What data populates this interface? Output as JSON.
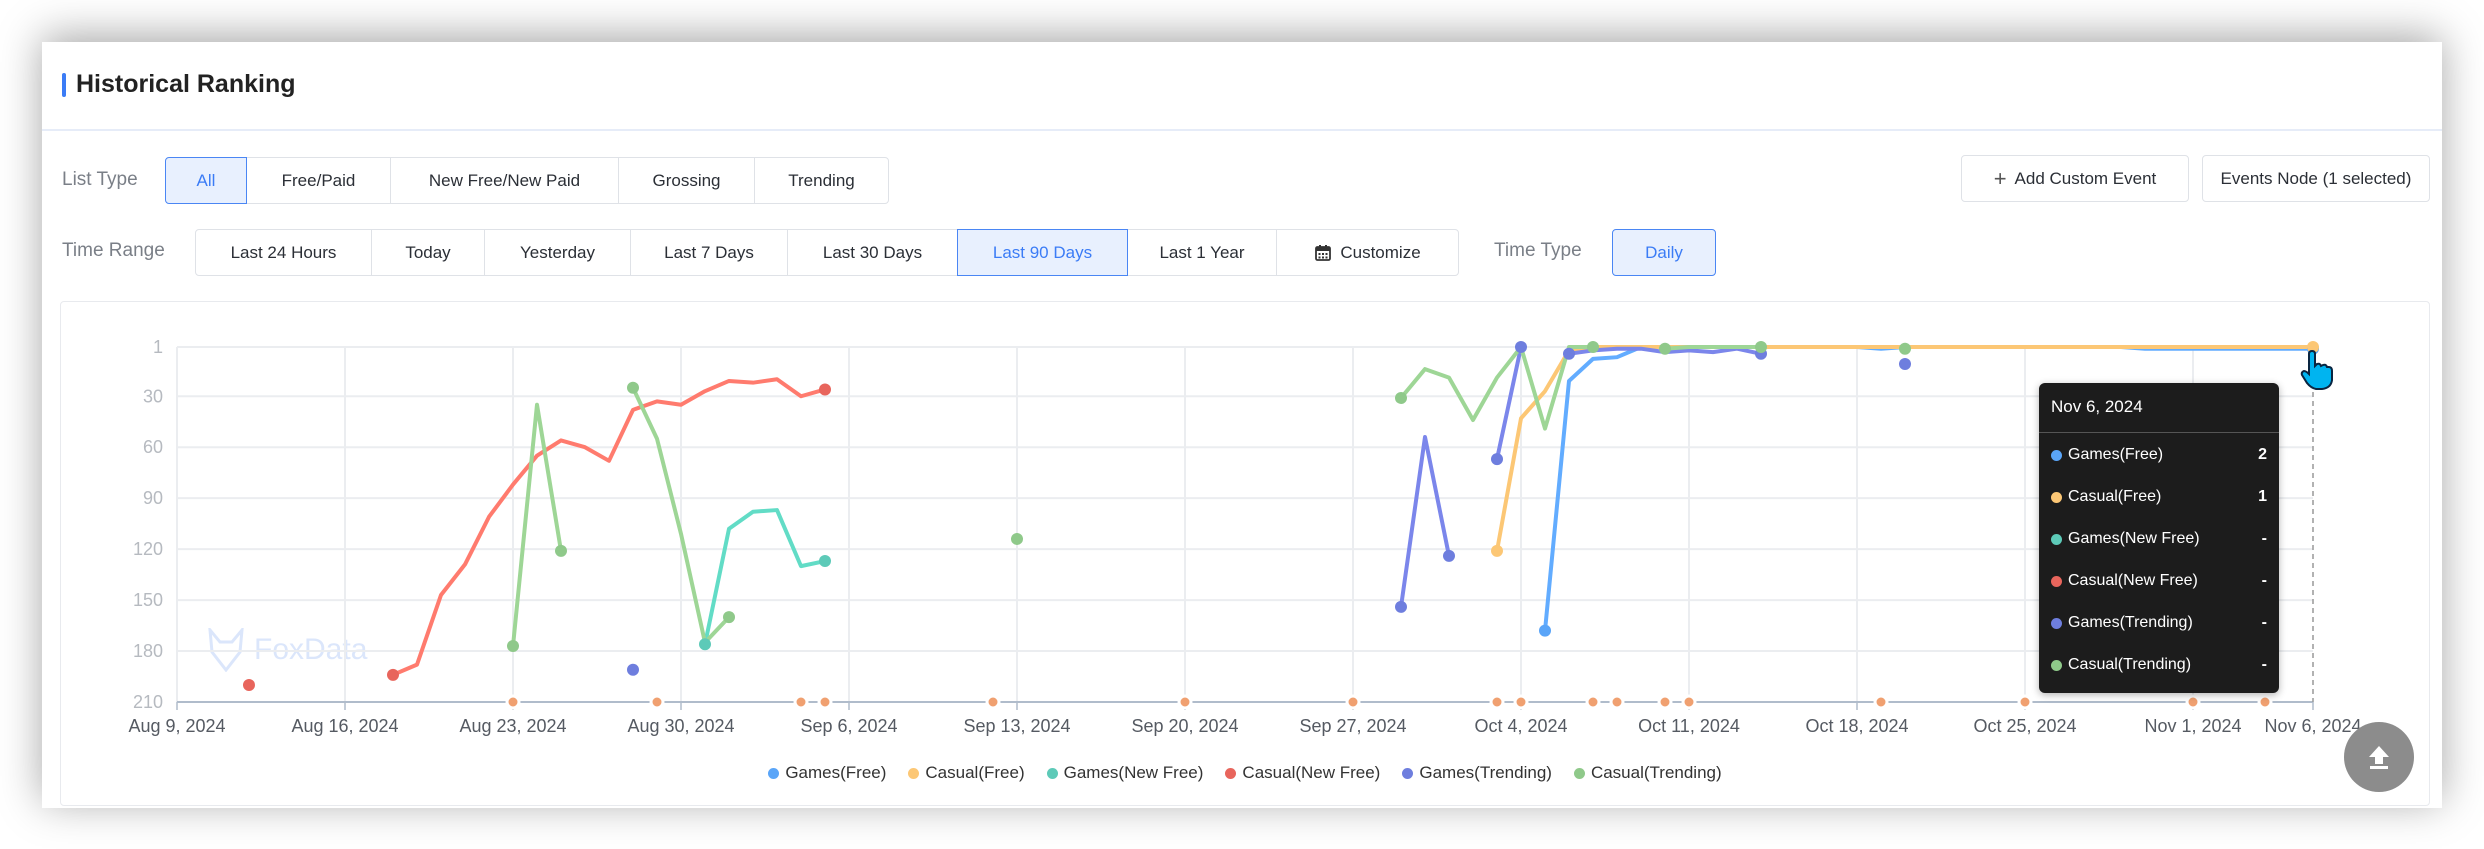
{
  "header": {
    "title": "Historical Ranking"
  },
  "filters": {
    "list_type_label": "List Type",
    "list_types": [
      "All",
      "Free/Paid",
      "New Free/New Paid",
      "Grossing",
      "Trending"
    ],
    "list_type_selected": "All",
    "time_range_label": "Time Range",
    "time_ranges": [
      "Last 24 Hours",
      "Today",
      "Yesterday",
      "Last 7 Days",
      "Last 30 Days",
      "Last 90 Days",
      "Last 1 Year",
      "Customize"
    ],
    "time_range_selected": "Last 90 Days",
    "time_type_label": "Time Type",
    "time_type": "Daily",
    "add_custom_event": "Add Custom Event",
    "events_node": "Events Node (1 selected)"
  },
  "watermark": "FoxData",
  "tooltip": {
    "date": "Nov 6, 2024",
    "rows": [
      {
        "name": "Games(Free)",
        "value": "2",
        "color": "#5aa5f8"
      },
      {
        "name": "Casual(Free)",
        "value": "1",
        "color": "#fcc775"
      },
      {
        "name": "Games(New Free)",
        "value": "-",
        "color": "#5dcab8"
      },
      {
        "name": "Casual(New Free)",
        "value": "-",
        "color": "#e8655c"
      },
      {
        "name": "Games(Trending)",
        "value": "-",
        "color": "#6e7ede"
      },
      {
        "name": "Casual(Trending)",
        "value": "-",
        "color": "#8fc98a"
      }
    ]
  },
  "chart_data": {
    "type": "line",
    "title": "",
    "xlabel": "",
    "ylabel": "",
    "y_inverted": true,
    "ylim": [
      1,
      210
    ],
    "y_ticks": [
      "1",
      "30",
      "60",
      "90",
      "120",
      "150",
      "180",
      "210"
    ],
    "xlim": [
      "2024-08-09",
      "2024-11-06"
    ],
    "x_ticks": [
      {
        "date": "2024-08-09",
        "label": "Aug 9, 2024"
      },
      {
        "date": "2024-08-16",
        "label": "Aug 16, 2024"
      },
      {
        "date": "2024-08-23",
        "label": "Aug 23, 2024"
      },
      {
        "date": "2024-08-30",
        "label": "Aug 30, 2024"
      },
      {
        "date": "2024-09-06",
        "label": "Sep 6, 2024"
      },
      {
        "date": "2024-09-13",
        "label": "Sep 13, 2024"
      },
      {
        "date": "2024-09-20",
        "label": "Sep 20, 2024"
      },
      {
        "date": "2024-09-27",
        "label": "Sep 27, 2024"
      },
      {
        "date": "2024-10-04",
        "label": "Oct 4, 2024"
      },
      {
        "date": "2024-10-11",
        "label": "Oct 11, 2024"
      },
      {
        "date": "2024-10-18",
        "label": "Oct 18, 2024"
      },
      {
        "date": "2024-10-25",
        "label": "Oct 25, 2024"
      },
      {
        "date": "2024-11-01",
        "label": "Nov 1, 2024"
      },
      {
        "date": "2024-11-06",
        "label": "Nov 6, 2024"
      }
    ],
    "grid": true,
    "legend_position": "bottom",
    "event_color": "#f0a070",
    "events": [
      "2024-08-23",
      "2024-08-29",
      "2024-09-04",
      "2024-09-05",
      "2024-09-12",
      "2024-09-20",
      "2024-09-27",
      "2024-10-03",
      "2024-10-04",
      "2024-10-07",
      "2024-10-08",
      "2024-10-10",
      "2024-10-11",
      "2024-10-19",
      "2024-10-25",
      "2024-11-01",
      "2024-11-04"
    ],
    "series": [
      {
        "name": "Games(Free)",
        "color": "#62acff",
        "dot_color": "#5aa5f8",
        "segments": [
          [
            [
              "2024-10-05",
              168
            ],
            [
              "2024-10-06",
              21
            ],
            [
              "2024-10-07",
              8
            ],
            [
              "2024-10-08",
              7
            ],
            [
              "2024-10-09",
              1
            ],
            [
              "2024-10-18",
              1
            ],
            [
              "2024-10-19",
              2
            ],
            [
              "2024-10-20",
              1
            ],
            [
              "2024-10-29",
              1
            ],
            [
              "2024-10-30",
              2
            ],
            [
              "2024-11-06",
              2
            ]
          ]
        ]
      },
      {
        "name": "Casual(Free)",
        "color": "#fcc775",
        "dot_color": "#fcc775",
        "segments": [
          [
            [
              "2024-10-03",
              121
            ],
            [
              "2024-10-04",
              43
            ],
            [
              "2024-10-05",
              27
            ],
            [
              "2024-10-06",
              3
            ],
            [
              "2024-10-07",
              1
            ],
            [
              "2024-11-06",
              1
            ]
          ]
        ]
      },
      {
        "name": "Games(New Free)",
        "color": "#62dcc6",
        "dot_color": "#5dcab8",
        "segments": [
          [
            [
              "2024-08-31",
              176
            ],
            [
              "2024-09-01",
              108
            ],
            [
              "2024-09-02",
              98
            ],
            [
              "2024-09-03",
              97
            ],
            [
              "2024-09-04",
              130
            ],
            [
              "2024-09-05",
              127
            ]
          ]
        ]
      },
      {
        "name": "Casual(New Free)",
        "color": "#ff7b6e",
        "dot_color": "#e8655c",
        "segments": [
          [
            [
              "2024-08-12",
              200
            ]
          ],
          [
            [
              "2024-08-18",
              194
            ],
            [
              "2024-08-19",
              188
            ],
            [
              "2024-08-20",
              147
            ],
            [
              "2024-08-21",
              129
            ],
            [
              "2024-08-22",
              101
            ],
            [
              "2024-08-23",
              82
            ],
            [
              "2024-08-24",
              65
            ],
            [
              "2024-08-25",
              56
            ],
            [
              "2024-08-26",
              60
            ],
            [
              "2024-08-27",
              68
            ],
            [
              "2024-08-28",
              38
            ],
            [
              "2024-08-29",
              33
            ],
            [
              "2024-08-30",
              35
            ],
            [
              "2024-08-31",
              27
            ],
            [
              "2024-09-01",
              21
            ],
            [
              "2024-09-02",
              22
            ],
            [
              "2024-09-03",
              20
            ],
            [
              "2024-09-04",
              30
            ],
            [
              "2024-09-05",
              26
            ]
          ]
        ]
      },
      {
        "name": "Games(Trending)",
        "color": "#7b86eb",
        "dot_color": "#6e7ede",
        "segments": [
          [
            [
              "2024-08-28",
              191
            ]
          ],
          [
            [
              "2024-09-29",
              154
            ],
            [
              "2024-09-30",
              54
            ],
            [
              "2024-10-01",
              124
            ]
          ],
          [
            [
              "2024-10-03",
              67
            ],
            [
              "2024-10-04",
              1
            ]
          ],
          [
            [
              "2024-10-06",
              5
            ],
            [
              "2024-10-07",
              3
            ],
            [
              "2024-10-08",
              2
            ],
            [
              "2024-10-09",
              2
            ],
            [
              "2024-10-10",
              4
            ],
            [
              "2024-10-11",
              3
            ],
            [
              "2024-10-12",
              4
            ],
            [
              "2024-10-13",
              2
            ],
            [
              "2024-10-14",
              5
            ]
          ],
          [
            [
              "2024-10-20",
              11
            ]
          ]
        ]
      },
      {
        "name": "Casual(Trending)",
        "color": "#9ed696",
        "dot_color": "#8fc98a",
        "segments": [
          [
            [
              "2024-08-23",
              177
            ],
            [
              "2024-08-24",
              35
            ],
            [
              "2024-08-25",
              121
            ]
          ],
          [
            [
              "2024-08-28",
              25
            ],
            [
              "2024-08-29",
              55
            ],
            [
              "2024-08-30",
              111
            ],
            [
              "2024-08-31",
              175
            ],
            [
              "2024-09-01",
              160
            ]
          ],
          [
            [
              "2024-09-13",
              114
            ]
          ],
          [
            [
              "2024-09-29",
              31
            ],
            [
              "2024-09-30",
              14
            ],
            [
              "2024-10-01",
              19
            ],
            [
              "2024-10-02",
              44
            ],
            [
              "2024-10-03",
              19
            ],
            [
              "2024-10-04",
              1
            ],
            [
              "2024-10-05",
              49
            ],
            [
              "2024-10-06",
              1
            ],
            [
              "2024-10-07",
              1
            ]
          ],
          [
            [
              "2024-10-10",
              2
            ],
            [
              "2024-10-11",
              1
            ],
            [
              "2024-10-14",
              1
            ]
          ],
          [
            [
              "2024-10-20",
              2
            ]
          ]
        ]
      }
    ]
  }
}
